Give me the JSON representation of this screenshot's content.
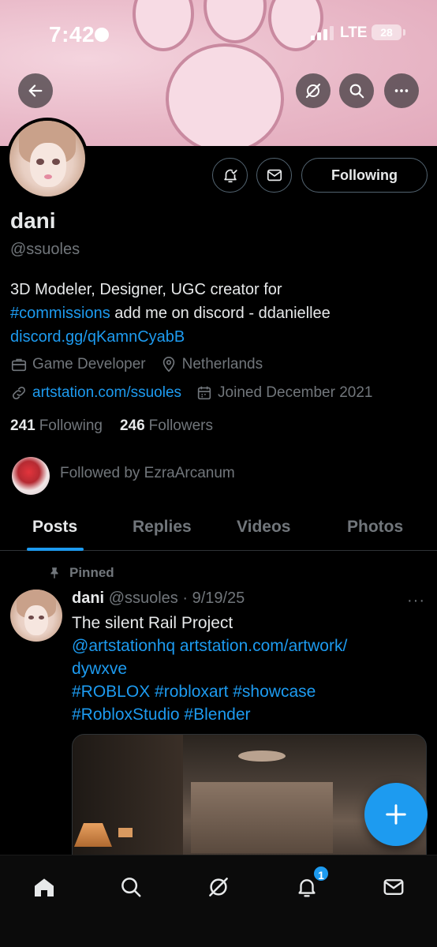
{
  "status_bar": {
    "time": "7:42",
    "network": "LTE",
    "battery": "28"
  },
  "header": {
    "icons": [
      "back-arrow-icon",
      "grok-icon",
      "search-icon",
      "more-icon"
    ]
  },
  "profile": {
    "name": "dani",
    "handle": "@ssuoles",
    "following_button": "Following",
    "bio_line1": "3D Modeler, Designer, UGC creator for",
    "bio_hashtag": "#commissions",
    "bio_line2_rest": " add me on discord - ddaniellee",
    "bio_link": "discord.gg/qKamnCyabB",
    "category": "Game Developer",
    "location": "Netherlands",
    "website": "artstation.com/ssuoles",
    "joined": "Joined December 2021",
    "following_count": "241",
    "following_label": "Following",
    "followers_count": "246",
    "followers_label": "Followers",
    "followed_by": "Followed by EzraArcanum"
  },
  "tabs": [
    {
      "label": "Posts",
      "active": true
    },
    {
      "label": "Replies",
      "active": false
    },
    {
      "label": "Videos",
      "active": false
    },
    {
      "label": "Photos",
      "active": false
    }
  ],
  "post": {
    "pinned_label": "Pinned",
    "author": "dani",
    "meta": "@ssuoles · 9/19/25",
    "more": "···",
    "line1": "The silent Rail Project",
    "mention": "@artstationhq",
    "link1": "artstation.com/artwork/",
    "link2": "dywxve",
    "hashtags1": "#ROBLOX #robloxart #showcase",
    "hashtags2": "#RobloxStudio #Blender"
  },
  "bottom_nav": {
    "items": [
      "home-icon",
      "search-icon",
      "grok-icon",
      "notifications-icon",
      "messages-icon"
    ],
    "notification_badge": "1"
  },
  "colors": {
    "accent": "#1d9bf0",
    "background": "#000000",
    "muted": "#71767b",
    "text": "#e7e9ea"
  }
}
